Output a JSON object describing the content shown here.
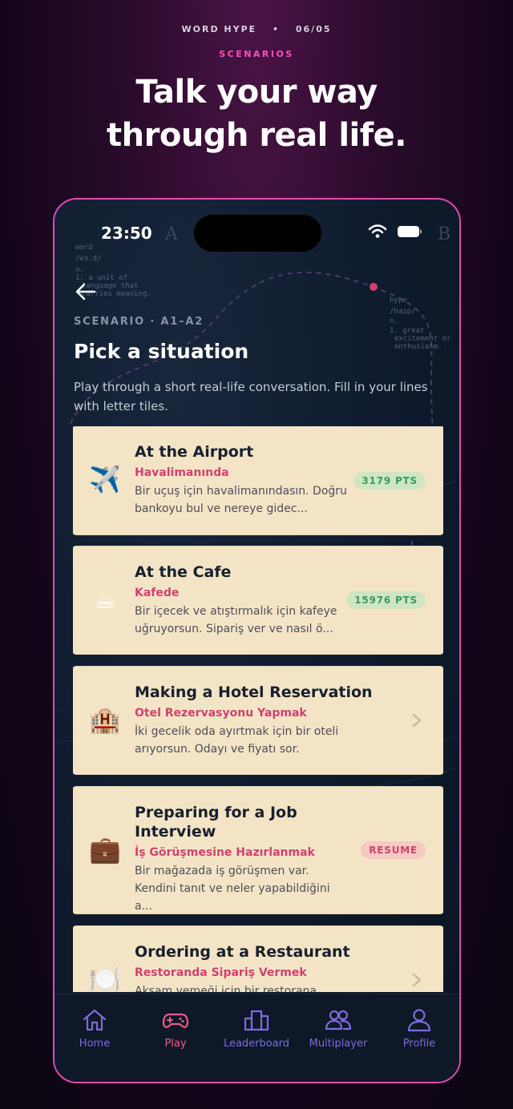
{
  "promo": {
    "app_name": "WORD HYPE",
    "page_indicator": "06/05",
    "section": "SCENARIOS",
    "headline_line1": "Talk your way",
    "headline_line2": "through real life."
  },
  "status_bar": {
    "time": "23:50"
  },
  "background_text": {
    "word_entry": [
      "word",
      "/wɜːd/",
      "n.",
      "1. a unit of",
      "language that",
      "carries meaning."
    ],
    "hype_entry": [
      "hype",
      "/haɪp/",
      "n.",
      "1. great",
      "excitement or",
      "enthusiasm."
    ],
    "letters": [
      "A",
      "B"
    ]
  },
  "header": {
    "scenario_label": "SCENARIO · A1–A2",
    "title": "Pick a situation",
    "description": "Play through a short real-life conversation. Fill in your lines with letter tiles."
  },
  "scenarios": [
    {
      "emoji": "✈️",
      "title": "At the Airport",
      "subtitle": "Havalimanında",
      "desc": "Bir uçuş için havalimanındasın. Doğru bankoyu bul ve nereye gidec...",
      "badge": "3179 PTS",
      "badge_type": "pts"
    },
    {
      "emoji": "☕",
      "title": "At the Cafe",
      "subtitle": "Kafede",
      "desc": "Bir içecek ve atıştırmalık için kafeye uğruyorsun. Sipariş ver ve nasıl ö...",
      "badge": "15976 PTS",
      "badge_type": "pts"
    },
    {
      "emoji": "🏨",
      "title": "Making a Hotel Reservation",
      "subtitle": "Otel Rezervasyonu Yapmak",
      "desc": "İki gecelik oda ayırtmak için bir oteli arıyorsun. Odayı ve fiyatı sor.",
      "badge": "",
      "badge_type": "chevron"
    },
    {
      "emoji": "💼",
      "title": "Preparing for a Job Interview",
      "subtitle": "İş Görüşmesine Hazırlanmak",
      "desc": "Bir mağazada iş görüşmen var. Kendini tanıt ve neler yapabildiğini a...",
      "badge": "RESUME",
      "badge_type": "resume"
    },
    {
      "emoji": "🍽️",
      "title": "Ordering at a Restaurant",
      "subtitle": "Restoranda Sipariş Vermek",
      "desc": "Akşam yemeği için bir restorana gidiyorsun.",
      "badge": "",
      "badge_type": "chevron"
    }
  ],
  "tabs": [
    {
      "label": "Home",
      "icon": "home-icon"
    },
    {
      "label": "Play",
      "icon": "gamepad-icon",
      "active": true
    },
    {
      "label": "Leaderboard",
      "icon": "leaderboard-icon"
    },
    {
      "label": "Multiplayer",
      "icon": "users-icon"
    },
    {
      "label": "Profile",
      "icon": "profile-icon"
    }
  ],
  "colors": {
    "accent_pink": "#e34bb5",
    "subtitle_red": "#d0416f",
    "tab_purple": "#7d6be0",
    "card_bg": "#f4e4c6"
  }
}
